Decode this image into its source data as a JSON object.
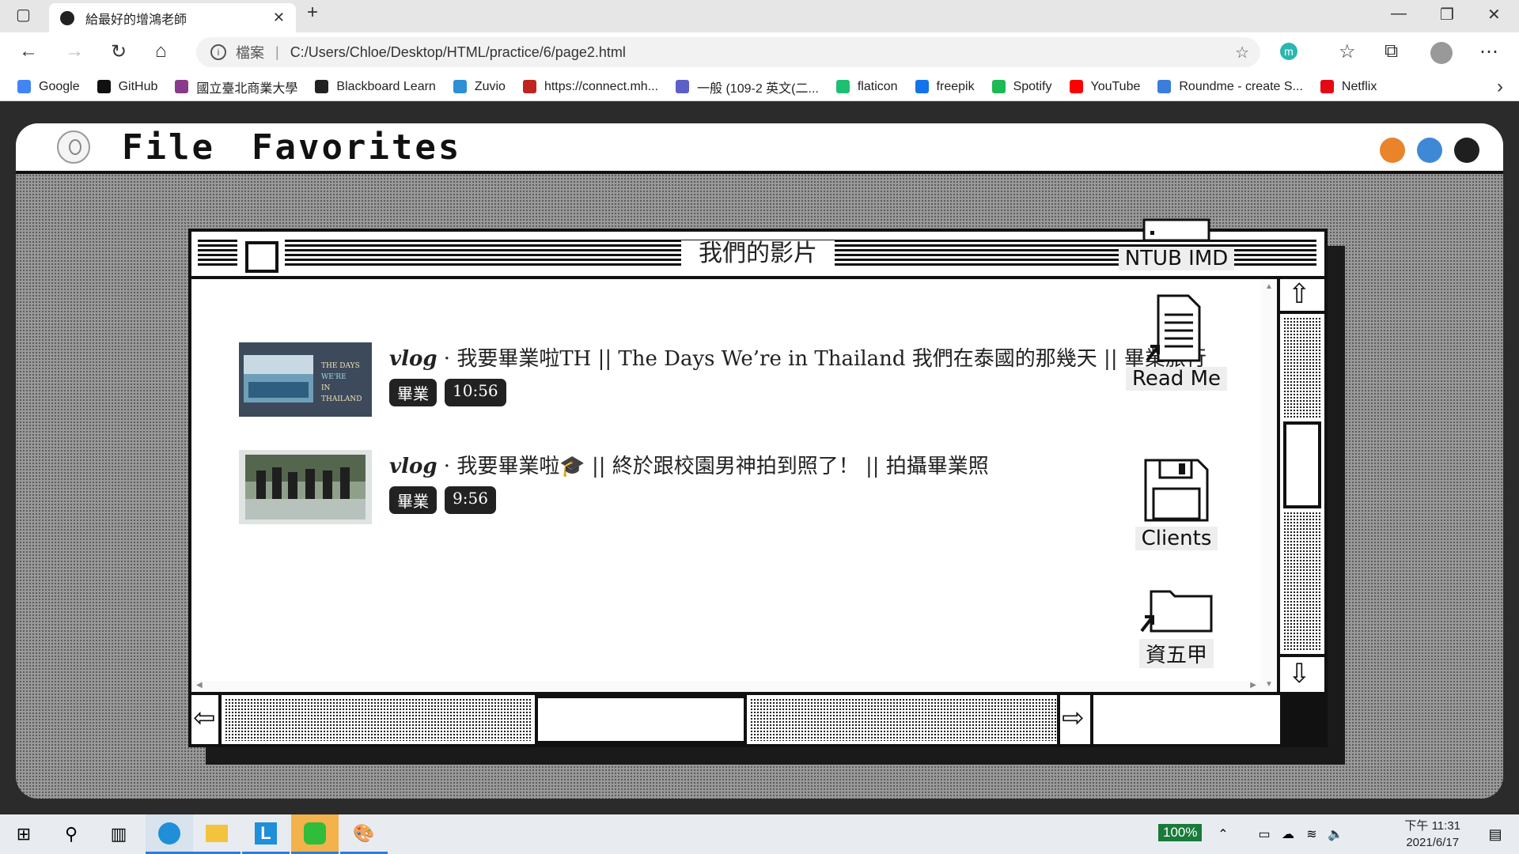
{
  "browser": {
    "tab_title": "給最好的增鴻老師",
    "url_label": "檔案",
    "url": "C:/Users/Chloe/Desktop/HTML/practice/6/page2.html",
    "bookmarks": [
      {
        "label": "Google",
        "color": "#4285f4"
      },
      {
        "label": "GitHub",
        "color": "#111111"
      },
      {
        "label": "國立臺北商業大學",
        "color": "#8a3a8a"
      },
      {
        "label": "Blackboard Learn",
        "color": "#222222"
      },
      {
        "label": "Zuvio",
        "color": "#2d8fd5"
      },
      {
        "label": "https://connect.mh...",
        "color": "#c0241f"
      },
      {
        "label": "一般 (109-2 英文(二...",
        "color": "#5b5fc7"
      },
      {
        "label": "flaticon",
        "color": "#1dbf73"
      },
      {
        "label": "freepik",
        "color": "#1273eb"
      },
      {
        "label": "Spotify",
        "color": "#1db954"
      },
      {
        "label": "YouTube",
        "color": "#ff0000"
      },
      {
        "label": "Roundme - create S...",
        "color": "#3b7ddd"
      },
      {
        "label": "Netflix",
        "color": "#e50914"
      }
    ]
  },
  "menubar": {
    "file": "File",
    "favorites": "Favorites",
    "dots": [
      "#e9842a",
      "#3f88d6",
      "#1f1f1f"
    ]
  },
  "window": {
    "title": "我們的影片"
  },
  "videos": [
    {
      "prefix": "vlog",
      "title": "我要畢業啦TH || The Days We’re in Thailand 我們在泰國的那幾天 || 畢業旅行",
      "tags": [
        "畢業",
        "10:56"
      ]
    },
    {
      "prefix": "vlog",
      "title": "我要畢業啦🎓 || 終於跟校園男神拍到照了！ || 拍攝畢業照",
      "tags": [
        "畢業",
        "9:56"
      ]
    }
  ],
  "desktop_icons": [
    {
      "label": "NTUB IMD",
      "icon": "drive-icon"
    },
    {
      "label": "Read Me",
      "icon": "document-icon"
    },
    {
      "label": "Clients",
      "icon": "floppy-icon"
    },
    {
      "label": "資五甲",
      "icon": "folder-icon"
    }
  ],
  "taskbar": {
    "battery": "100%",
    "time": "下午 11:31",
    "date": "2021/6/17"
  }
}
